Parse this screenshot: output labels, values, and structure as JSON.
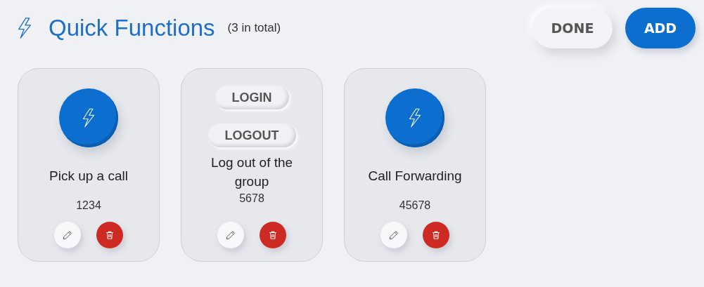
{
  "header": {
    "title": "Quick Functions",
    "count": "(3 in total)"
  },
  "actions": [
    {
      "label": "DONE",
      "kind": "secondary"
    },
    {
      "label": "ADD",
      "kind": "primary"
    }
  ],
  "cards": [
    {
      "kind": "icon",
      "name": "Pick up a call",
      "number": "1234"
    },
    {
      "kind": "buttons",
      "buttons": [
        "LOGIN",
        "LOGOUT"
      ],
      "name": "Log out of the group",
      "number": "5678"
    },
    {
      "kind": "icon",
      "name": "Call Forwarding",
      "number": "45678"
    }
  ]
}
